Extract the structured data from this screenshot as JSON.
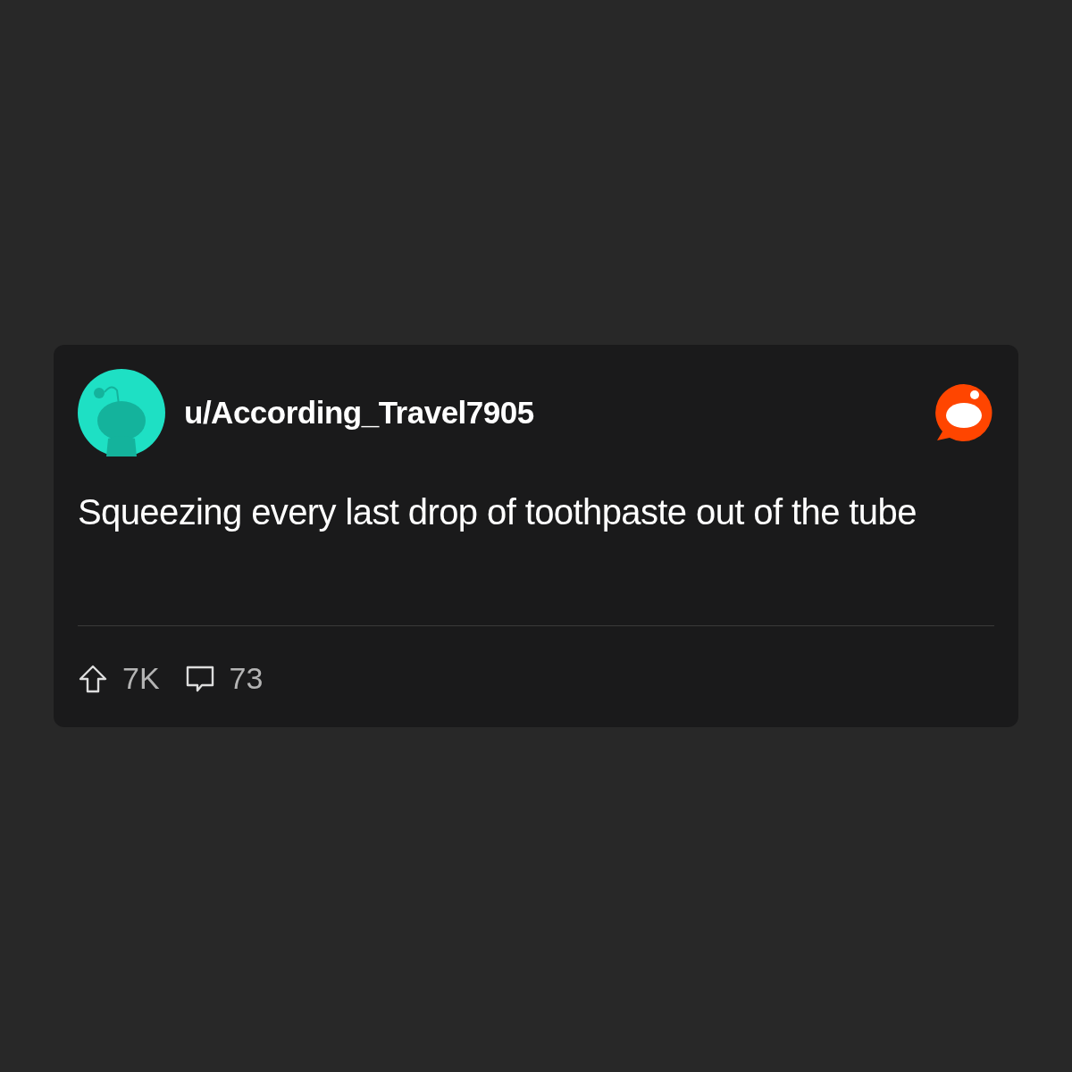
{
  "post": {
    "username": "u/According_Travel7905",
    "title": "Squeezing every last drop of toothpaste out of the tube",
    "upvotes": "7K",
    "comments": "73"
  }
}
